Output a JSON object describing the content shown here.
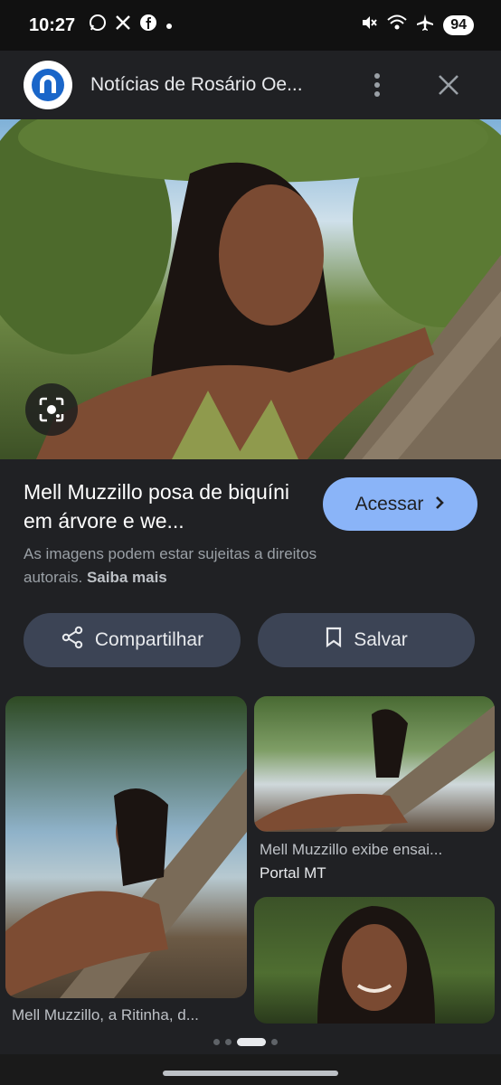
{
  "status_bar": {
    "time": "10:27",
    "battery": "94",
    "left_icons": [
      "whatsapp-icon",
      "x-icon",
      "facebook-icon",
      "dot-icon"
    ],
    "right_icons": [
      "mute-icon",
      "wifi-icon",
      "airplane-icon"
    ]
  },
  "header": {
    "title": "Notícias de Rosário Oe...",
    "logo_color": "#1a66c9"
  },
  "result": {
    "title": "Mell Muzzillo posa de biquíni em árvore e we...",
    "visit_label": "Acessar",
    "copyright_text": "As imagens podem estar sujeitas a direitos autorais.",
    "learn_more": "Saiba mais"
  },
  "actions": {
    "share_label": "Compartilhar",
    "save_label": "Salvar"
  },
  "related": [
    {
      "caption": "Mell Muzzillo, a Ritinha, d..."
    },
    {
      "caption": "Mell Muzzillo exibe ensai...",
      "source": "Portal MT"
    },
    {
      "caption": ""
    }
  ],
  "colors": {
    "background": "#202124",
    "accent": "#8ab4f8",
    "chip": "#3c4455"
  }
}
